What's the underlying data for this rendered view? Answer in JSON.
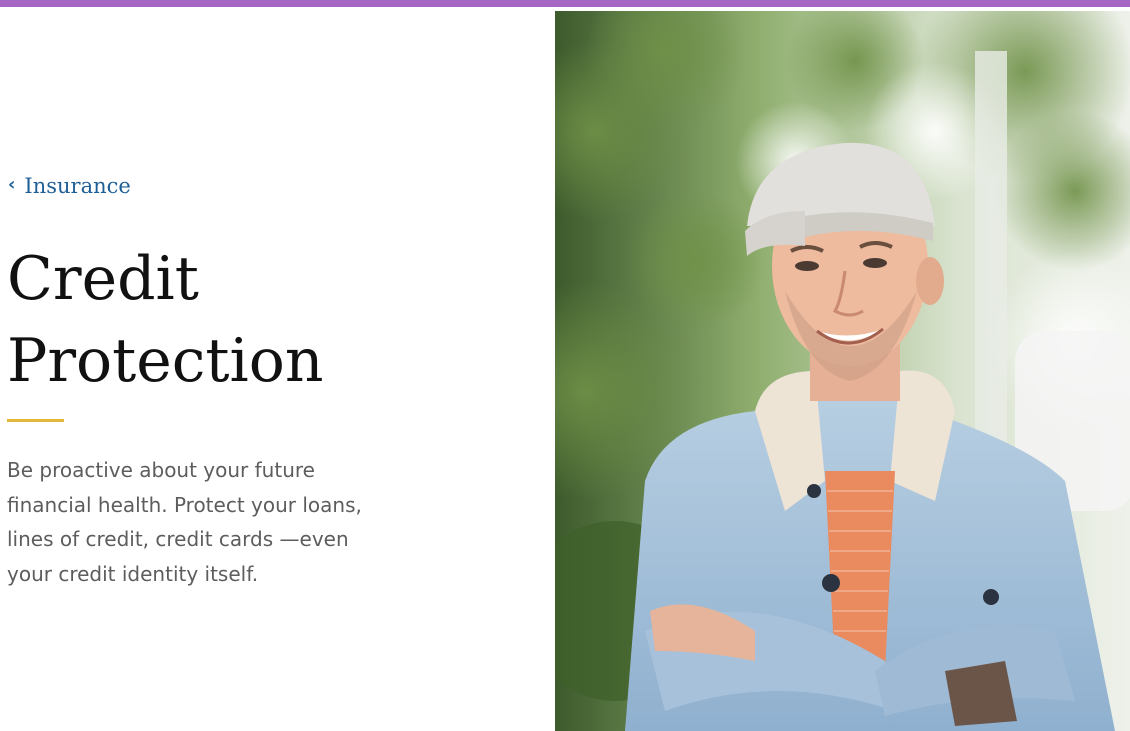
{
  "breadcrumb": {
    "label": "Insurance",
    "icon": "chevron-left-icon"
  },
  "page": {
    "title_line1": "Credit",
    "title_line2": "Protection",
    "description_lines": [
      "Be proactive about your future",
      "financial health. Protect your loans,",
      "lines of credit, credit cards —even",
      "your credit identity itself."
    ]
  },
  "colors": {
    "top_bar": "#a566c4",
    "link": "#1f5f97",
    "accent_divider": "#e3b73a",
    "title_text": "#111111",
    "body_text": "#5d5d5d"
  }
}
